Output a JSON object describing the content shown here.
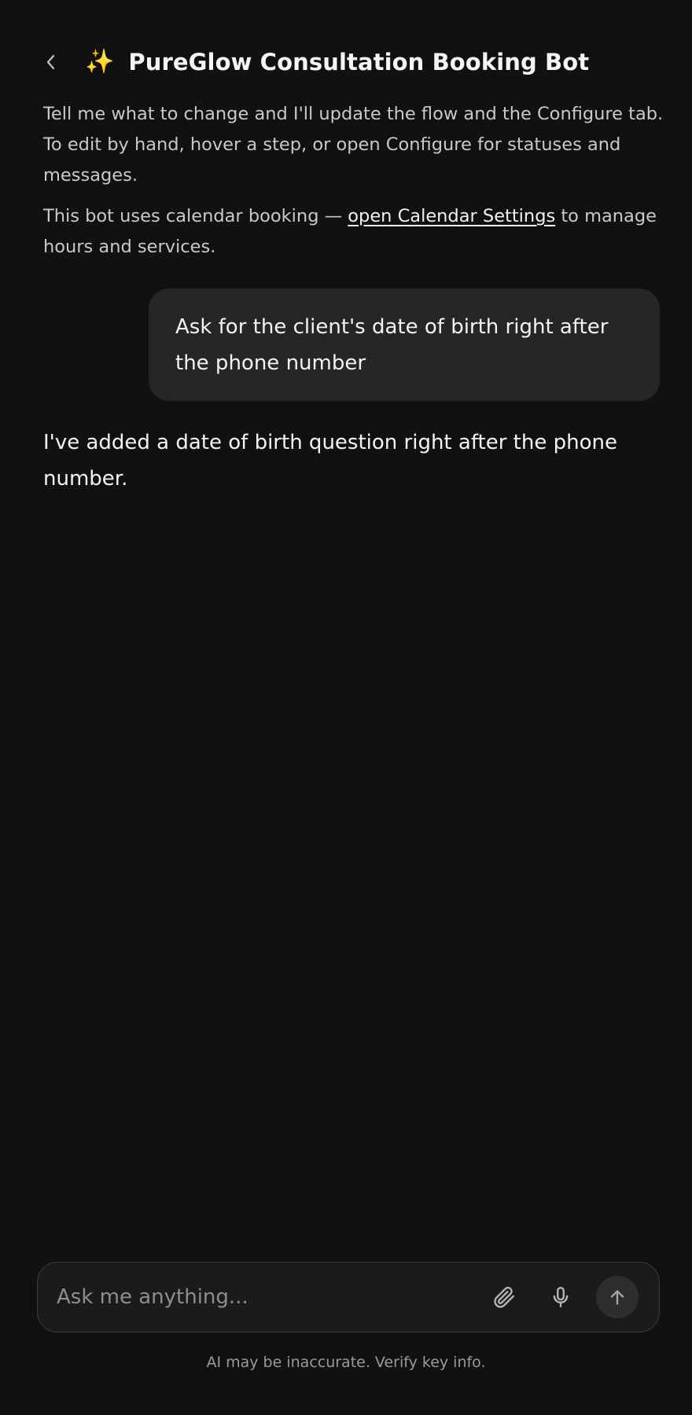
{
  "header": {
    "title": "PureGlow Consultation Booking Bot",
    "back_icon": "chevron-left-icon",
    "title_icon": "✨"
  },
  "intro": {
    "line1": "Tell me what to change and I'll update the flow and the Configure tab. To edit by hand, hover a step, or open Configure for statuses and messages.",
    "line2_prefix": "This bot uses calendar booking — ",
    "line2_link": "open Calendar Settings",
    "line2_suffix": " to manage hours and services."
  },
  "messages": {
    "user": "Ask for the client's date of birth right after the phone number",
    "bot": "I've added a date of birth question right after the phone number."
  },
  "composer": {
    "placeholder": "Ask me anything...",
    "attach_icon": "paperclip-icon",
    "mic_icon": "microphone-icon",
    "send_icon": "arrow-up-icon"
  },
  "footer": {
    "disclaimer": "AI may be inaccurate. Verify key info."
  },
  "colors": {
    "background": "#111111",
    "bubble": "#262626",
    "composer": "#1b1b1b",
    "sparkle": "#f5c84c"
  }
}
